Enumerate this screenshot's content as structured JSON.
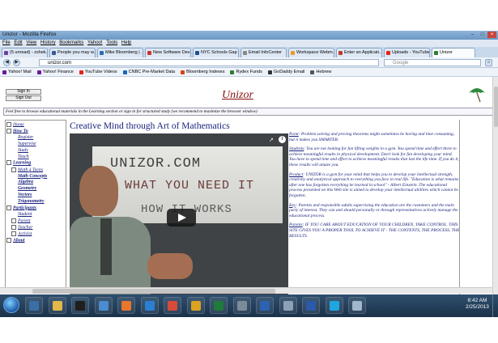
{
  "window": {
    "title": "Unizor - Mozilla Firefox",
    "controls": [
      "–",
      "□",
      "×"
    ]
  },
  "menu": [
    "File",
    "Edit",
    "View",
    "History",
    "Bookmarks",
    "Yahoo!",
    "Tools",
    "Help"
  ],
  "tabs": [
    {
      "label": "(5 unread) - zshek...",
      "color": "#6a3fa0"
    },
    {
      "label": "People you may w...",
      "color": "#3b5998"
    },
    {
      "label": "Mike Bloomberg | ...",
      "color": "#2b6cb0"
    },
    {
      "label": "New Software Dev...",
      "color": "#cc3333"
    },
    {
      "label": "NYC Schools Gap ...",
      "color": "#1f4e8c"
    },
    {
      "label": "Email InfoCenter",
      "color": "#888888"
    },
    {
      "label": "Workspace Webm...",
      "color": "#e89b2c"
    },
    {
      "label": "Enter an Applicati...",
      "color": "#c0392b"
    },
    {
      "label": "Uploads - YouTube",
      "color": "#e62117"
    },
    {
      "label": "Unizor",
      "color": "#2e7d32",
      "active": true
    }
  ],
  "navbar": {
    "back": "◀",
    "forward": "▶",
    "url": "unizor.com",
    "search_placeholder": "Google",
    "home": "⌂"
  },
  "bookmarks": [
    {
      "label": "Yahoo! Mail",
      "color": "#6a1b9a"
    },
    {
      "label": "Yahoo! Finance",
      "color": "#6a1b9a"
    },
    {
      "label": "YouTube Videos",
      "color": "#e62117"
    },
    {
      "label": "CNBC Pre-Market Data",
      "color": "#1565c0"
    },
    {
      "label": "Bloomberg Indexes",
      "color": "#d84315"
    },
    {
      "label": "Rydex Funds",
      "color": "#2e7d32"
    },
    {
      "label": "GoDaddy Email",
      "color": "#333333"
    },
    {
      "label": "Hebrew",
      "color": "#555555"
    }
  ],
  "page": {
    "sign_in": "Sign In",
    "sign_out": "Sign Out",
    "logo": "Unizor",
    "notice": "Feel free to browse educational materials in the Learning section or sign in for structured study (we recommend to maximize the browser window)",
    "heading": "Creative Mind through Art of Mathematics",
    "nav": [
      {
        "label": "Home",
        "level": 1,
        "style": "u",
        "box": true
      },
      {
        "label": "How To",
        "level": 1,
        "style": "b",
        "box": true
      },
      {
        "label": "Register",
        "level": 3,
        "style": "u",
        "box": false
      },
      {
        "label": "Supervise",
        "level": 3,
        "style": "u",
        "box": false
      },
      {
        "label": "Study",
        "level": 3,
        "style": "u",
        "box": false
      },
      {
        "label": "Teach",
        "level": 3,
        "style": "u",
        "box": false
      },
      {
        "label": "Learning",
        "level": 1,
        "style": "b",
        "box": true
      },
      {
        "label": "Math 4 Teens",
        "level": 2,
        "style": "u",
        "box": true
      },
      {
        "label": "Math Concepts",
        "level": 3,
        "style": "b",
        "box": false
      },
      {
        "label": "Algebra",
        "level": 3,
        "style": "b",
        "box": false
      },
      {
        "label": "Geometry",
        "level": 3,
        "style": "b",
        "box": false
      },
      {
        "label": "Vectors",
        "level": 3,
        "style": "b",
        "box": false
      },
      {
        "label": "Trigonometry",
        "level": 3,
        "style": "b",
        "box": false
      },
      {
        "label": "Participants",
        "level": 1,
        "style": "b",
        "box": true
      },
      {
        "label": "Student",
        "level": 3,
        "style": "u",
        "box": false
      },
      {
        "label": "Parent",
        "level": 2,
        "style": "u",
        "box": true
      },
      {
        "label": "Teacher",
        "level": 2,
        "style": "u",
        "box": true
      },
      {
        "label": "Activist",
        "level": 2,
        "style": "u",
        "box": true
      },
      {
        "label": "About",
        "level": 1,
        "style": "b",
        "box": true
      }
    ],
    "video": {
      "board_line1": "UNIZOR.COM",
      "board_line2": "WHAT YOU NEED IT",
      "board_line3": "HOW IT WORKS",
      "share": "↗",
      "info": "i"
    },
    "paragraphs": [
      {
        "label": "Point",
        "text": ": Problem solving and proving theorems might sometimes be boring and time consuming, but it makes you SMARTER."
      },
      {
        "label": "Students",
        "text": ": You are not looking for fun lifting weights in a gym. You spend time and effort there to achieve meaningful results in physical development. Don't look for fun developing your mind. You have to spend time and effort to achieve meaningful results that last the life time. If you do it, these results will amaze you."
      },
      {
        "label": "Product",
        "text": ": UNIZOR is a gym for your mind that helps you to develop your intellectual strength, creativity and analytical approach to everything you face in real life. \"Education is what remains after one has forgotten everything he learned in school\" - Albert Einstein. The educational process presented on this Web site is aimed to develop your intellectual abilities which cannot be forgotten."
      },
      {
        "label": "Key",
        "text": ": Parents and responsible adults supervising the education are the customers and the main party of interest. They can and should personally or through representatives actively manage the educational process."
      },
      {
        "label": "Parents",
        "text": ": IF YOU CARE ABOUT EDUCATION OF YOUR CHILDREN, TAKE CONTROL. THIS SITE GIVES YOU A PROPER TOOL TO ACHIEVE IT - THE CONTENTS, THE PROCESS, THE RESULTS."
      }
    ]
  },
  "taskbar": {
    "time": "8:42 AM",
    "date": "2/25/2013",
    "apps": [
      {
        "name": "computer",
        "color": "#3b6ea5"
      },
      {
        "name": "folder",
        "color": "#e2b84a"
      },
      {
        "name": "terminal",
        "color": "#1e1e1e"
      },
      {
        "name": "files",
        "color": "#4a8ccf"
      },
      {
        "name": "firefox",
        "color": "#e8762b"
      },
      {
        "name": "ie",
        "color": "#2b7fd1"
      },
      {
        "name": "chrome",
        "color": "#d84a3a"
      },
      {
        "name": "media",
        "color": "#d9a21f"
      },
      {
        "name": "excel",
        "color": "#1f7a3c"
      },
      {
        "name": "calculator",
        "color": "#7c8b99"
      },
      {
        "name": "outlook",
        "color": "#2d62b3"
      },
      {
        "name": "tools",
        "color": "#8aa1b8"
      },
      {
        "name": "word",
        "color": "#2b5aab"
      },
      {
        "name": "skype",
        "color": "#1ea6e0"
      },
      {
        "name": "docs",
        "color": "#9fb6cc"
      }
    ]
  }
}
